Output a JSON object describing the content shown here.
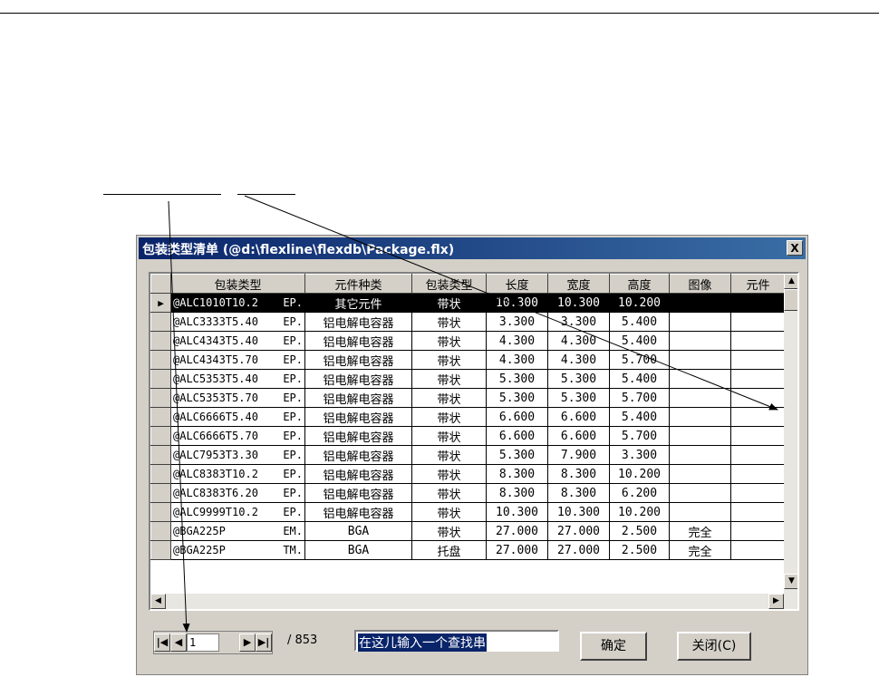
{
  "window": {
    "title": "包装类型清单 (@d:\\flexline\\flexdb\\Package.flx)",
    "close_label": "X"
  },
  "grid": {
    "columns": [
      "包装类型",
      "元件种类",
      "包装类型",
      "长度",
      "宽度",
      "高度",
      "图像",
      "元件"
    ],
    "rows": [
      {
        "name": "@ALC1010T10.2",
        "code": "EP.",
        "kind": "其它元件",
        "pack": "带状",
        "length": "10.300",
        "width": "10.300",
        "height": "10.200",
        "image": "",
        "extra": ""
      },
      {
        "name": "@ALC3333T5.40",
        "code": "EP.",
        "kind": "铝电解电容器",
        "pack": "带状",
        "length": "3.300",
        "width": "3.300",
        "height": "5.400",
        "image": "",
        "extra": ""
      },
      {
        "name": "@ALC4343T5.40",
        "code": "EP.",
        "kind": "铝电解电容器",
        "pack": "带状",
        "length": "4.300",
        "width": "4.300",
        "height": "5.400",
        "image": "",
        "extra": ""
      },
      {
        "name": "@ALC4343T5.70",
        "code": "EP.",
        "kind": "铝电解电容器",
        "pack": "带状",
        "length": "4.300",
        "width": "4.300",
        "height": "5.700",
        "image": "",
        "extra": ""
      },
      {
        "name": "@ALC5353T5.40",
        "code": "EP.",
        "kind": "铝电解电容器",
        "pack": "带状",
        "length": "5.300",
        "width": "5.300",
        "height": "5.400",
        "image": "",
        "extra": ""
      },
      {
        "name": "@ALC5353T5.70",
        "code": "EP.",
        "kind": "铝电解电容器",
        "pack": "带状",
        "length": "5.300",
        "width": "5.300",
        "height": "5.700",
        "image": "",
        "extra": ""
      },
      {
        "name": "@ALC6666T5.40",
        "code": "EP.",
        "kind": "铝电解电容器",
        "pack": "带状",
        "length": "6.600",
        "width": "6.600",
        "height": "5.400",
        "image": "",
        "extra": ""
      },
      {
        "name": "@ALC6666T5.70",
        "code": "EP.",
        "kind": "铝电解电容器",
        "pack": "带状",
        "length": "6.600",
        "width": "6.600",
        "height": "5.700",
        "image": "",
        "extra": ""
      },
      {
        "name": "@ALC7953T3.30",
        "code": "EP.",
        "kind": "铝电解电容器",
        "pack": "带状",
        "length": "5.300",
        "width": "7.900",
        "height": "3.300",
        "image": "",
        "extra": ""
      },
      {
        "name": "@ALC8383T10.2",
        "code": "EP.",
        "kind": "铝电解电容器",
        "pack": "带状",
        "length": "8.300",
        "width": "8.300",
        "height": "10.200",
        "image": "",
        "extra": ""
      },
      {
        "name": "@ALC8383T6.20",
        "code": "EP.",
        "kind": "铝电解电容器",
        "pack": "带状",
        "length": "8.300",
        "width": "8.300",
        "height": "6.200",
        "image": "",
        "extra": ""
      },
      {
        "name": "@ALC9999T10.2",
        "code": "EP.",
        "kind": "铝电解电容器",
        "pack": "带状",
        "length": "10.300",
        "width": "10.300",
        "height": "10.200",
        "image": "",
        "extra": ""
      },
      {
        "name": "@BGA225P",
        "code": "EM.",
        "kind": "BGA",
        "pack": "带状",
        "length": "27.000",
        "width": "27.000",
        "height": "2.500",
        "image": "完全",
        "extra": ""
      },
      {
        "name": "@BGA225P",
        "code": "TM.",
        "kind": "BGA",
        "pack": "托盘",
        "length": "27.000",
        "width": "27.000",
        "height": "2.500",
        "image": "完全",
        "extra": ""
      }
    ],
    "selected_row": 0
  },
  "nav": {
    "page_value": "1",
    "total": "/ 853"
  },
  "search": {
    "text": "在这儿输入一个查找串"
  },
  "buttons": {
    "ok": "确定",
    "close": "关闭(C)"
  }
}
